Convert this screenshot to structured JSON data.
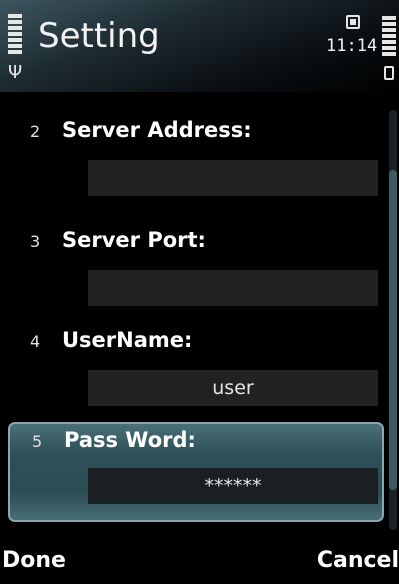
{
  "header": {
    "title": "Setting",
    "time": "11:14",
    "icons": [
      "signal-strength-icon",
      "antenna-icon",
      "calendar-icon",
      "battery-icon"
    ]
  },
  "fields": [
    {
      "number": "2",
      "label": "Server Address:",
      "value": ""
    },
    {
      "number": "3",
      "label": "Server Port:",
      "value": ""
    },
    {
      "number": "4",
      "label": "UserName:",
      "value": "user"
    },
    {
      "number": "5",
      "label": "Pass Word:",
      "value": "******"
    }
  ],
  "softkeys": {
    "left": "Done",
    "right": "Cancel"
  },
  "colors": {
    "focus_highlight": "#2f5058",
    "input_bg": "#222222"
  }
}
